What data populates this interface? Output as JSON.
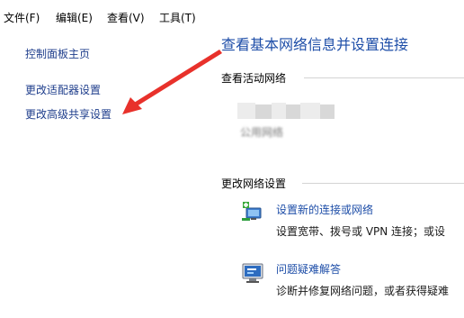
{
  "menubar": {
    "items": [
      {
        "label": "文件(F)"
      },
      {
        "label": "编辑(E)"
      },
      {
        "label": "查看(V)"
      },
      {
        "label": "工具(T)"
      }
    ]
  },
  "sidebar": {
    "items": [
      {
        "label": "控制面板主页"
      },
      {
        "label": "更改适配器设置"
      },
      {
        "label": "更改高级共享设置"
      }
    ]
  },
  "main": {
    "title": "查看基本网络信息并设置连接",
    "active_networks_header": "查看活动网络",
    "network_type": "公用网络",
    "change_settings_header": "更改网络设置",
    "tasks": [
      {
        "label": "设置新的连接或网络",
        "description": "设置宽带、拨号或 VPN 连接；或设",
        "icon": "network-setup-icon"
      },
      {
        "label": "问题疑难解答",
        "description": "诊断并修复网络问题，或者获得疑难",
        "icon": "troubleshoot-icon"
      }
    ]
  },
  "annotation": {
    "arrow_color": "#e8312b"
  }
}
